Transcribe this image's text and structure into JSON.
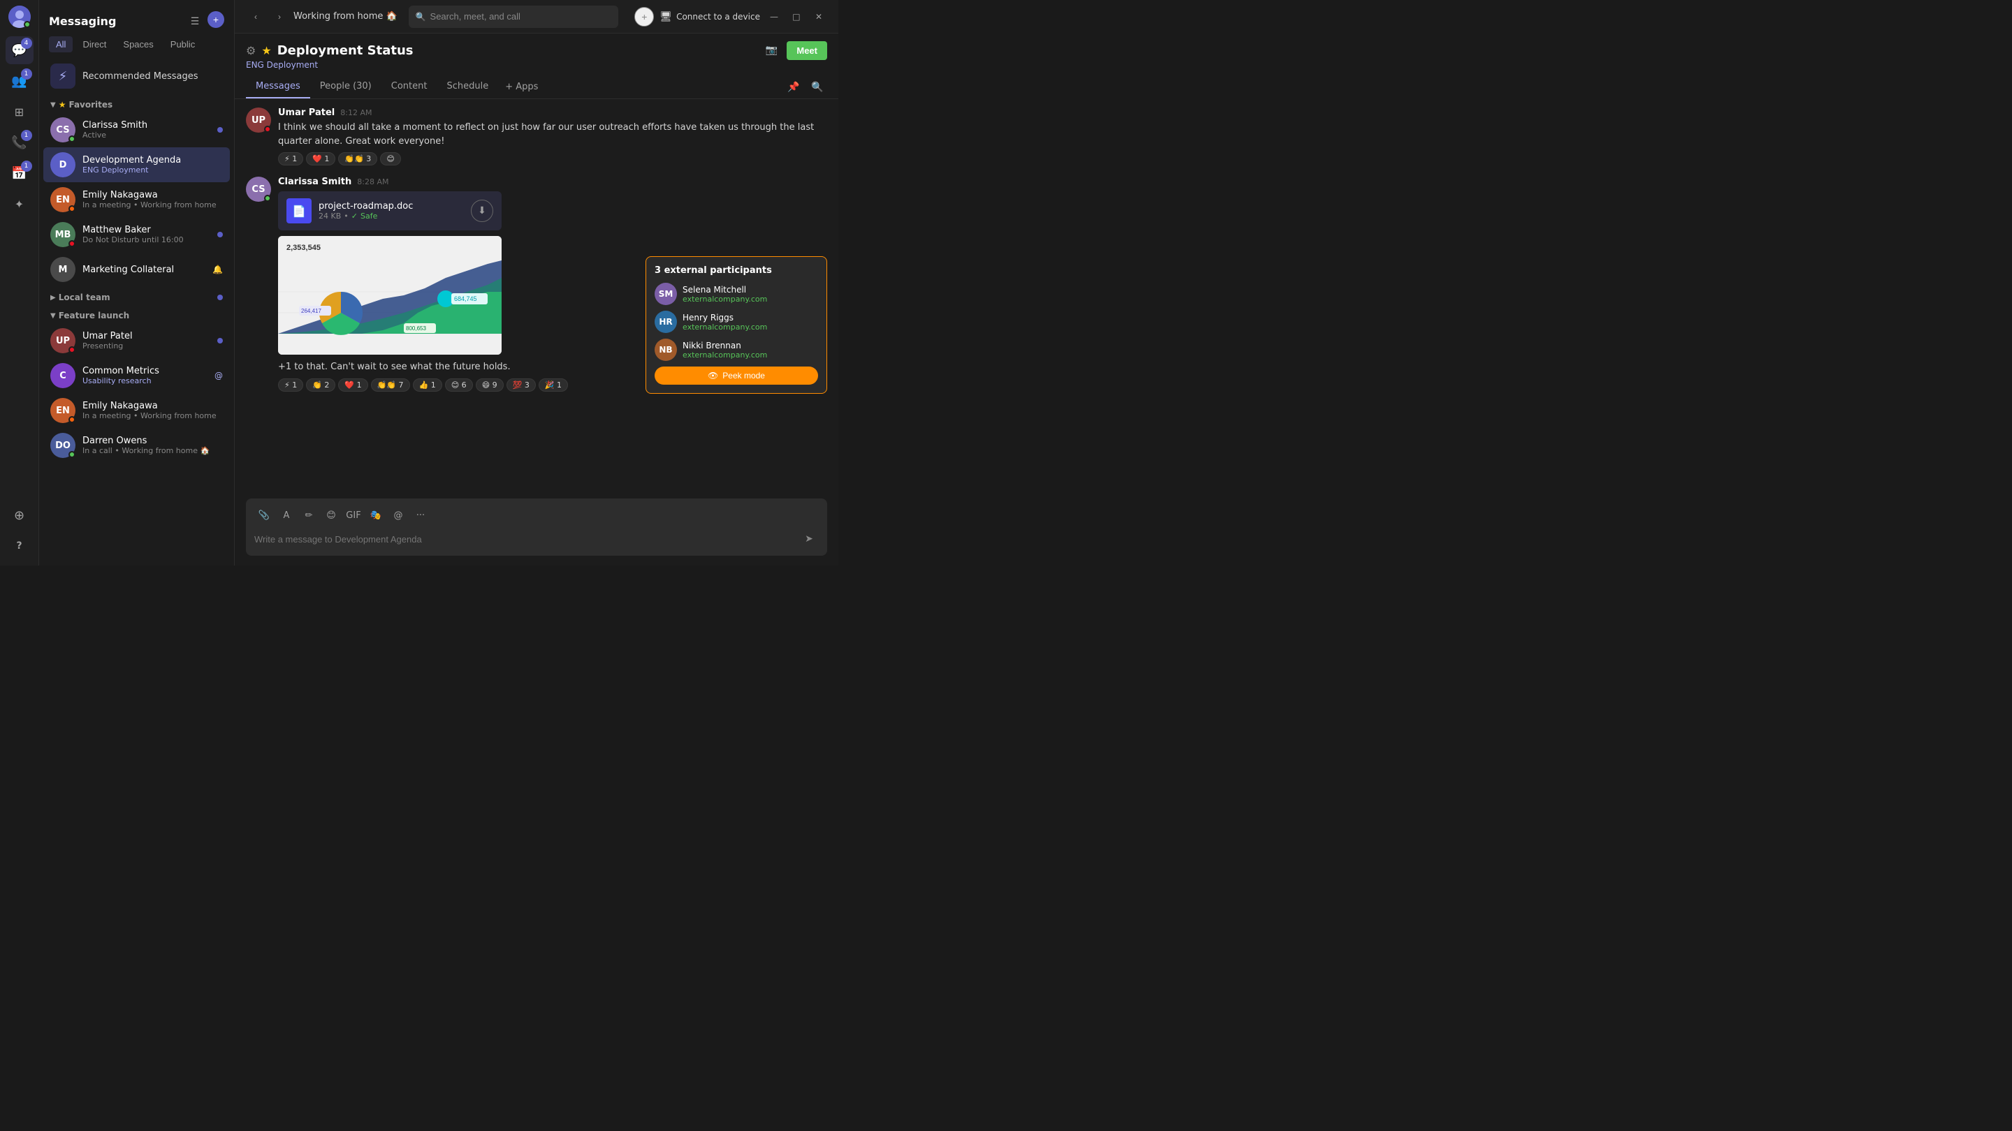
{
  "topBar": {
    "title": "Working from home 🏠",
    "searchPlaceholder": "Search, meet, and call",
    "connectBtn": "Connect to a device"
  },
  "sidebar": {
    "title": "Messaging",
    "tabs": [
      "All",
      "Direct",
      "Spaces",
      "Public"
    ],
    "activeTab": "All",
    "recommendedMessages": "Recommended Messages",
    "sections": {
      "favorites": {
        "label": "Favorites",
        "expanded": true,
        "items": [
          {
            "id": "clarissa",
            "name": "Clarissa Smith",
            "sub": "Active",
            "status": "green",
            "hasBadge": true,
            "bgColor": "#8b6fad"
          },
          {
            "id": "dev-agenda",
            "name": "Development Agenda",
            "sub": "ENG Deployment",
            "status": null,
            "hasBadge": false,
            "bgColor": "#5b5fc7",
            "letter": "D",
            "active": true
          },
          {
            "id": "emily1",
            "name": "Emily Nakagawa",
            "sub": "In a meeting • Working from home",
            "status": "orange",
            "hasBadge": false,
            "bgColor": "#c45b2a"
          },
          {
            "id": "matthew",
            "name": "Matthew Baker",
            "sub": "Do Not Disturb until 16:00",
            "status": "dnd",
            "hasBadge": true,
            "bgColor": "#4a7c59"
          }
        ]
      },
      "localTeam": {
        "label": "Local team",
        "expanded": false,
        "hasBadge": true
      },
      "featureLaunch": {
        "label": "Feature launch",
        "expanded": true,
        "items": [
          {
            "id": "umar",
            "name": "Umar Patel",
            "sub": "Presenting",
            "status": "presenting",
            "hasBadge": true,
            "bgColor": "#8b3a3a"
          },
          {
            "id": "common",
            "name": "Common Metrics",
            "sub": "Usability research",
            "status": null,
            "hasBadge": false,
            "bgColor": "#7b3fc7",
            "letter": "C",
            "hasAt": true
          },
          {
            "id": "emily2",
            "name": "Emily Nakagawa",
            "sub": "In a meeting • Working from home",
            "status": "orange",
            "hasBadge": false,
            "bgColor": "#c45b2a"
          },
          {
            "id": "darren",
            "name": "Darren Owens",
            "sub": "In a call • Working from home 🏠",
            "status": "green",
            "hasBadge": false,
            "bgColor": "#4a5c9a"
          }
        ]
      }
    },
    "marketing": {
      "name": "Marketing Collateral",
      "letter": "M",
      "bgColor": "#4a4a4a",
      "muted": true
    }
  },
  "channel": {
    "name": "Deployment Status",
    "sub": "ENG Deployment",
    "tabs": [
      "Messages",
      "People (30)",
      "Content",
      "Schedule",
      "+ Apps"
    ],
    "activeTab": "Messages",
    "messages": [
      {
        "id": "umar-msg",
        "author": "Umar Patel",
        "time": "8:12 AM",
        "text": "I think we should all take a moment to reflect on just how far our user outreach efforts have taken us through the last quarter alone. Great work everyone!",
        "reactions": [
          {
            "emoji": "⚡",
            "count": "1"
          },
          {
            "emoji": "❤️",
            "count": "1"
          },
          {
            "emoji": "👏👏",
            "count": "3"
          },
          {
            "emoji": "😊",
            "count": ""
          }
        ],
        "avatarBg": "#8b3a3a",
        "avatarLetter": "U"
      },
      {
        "id": "clarissa-msg",
        "author": "Clarissa Smith",
        "time": "8:28 AM",
        "file": {
          "name": "project-roadmap.doc",
          "size": "24 KB",
          "safe": true
        },
        "text": "+1 to that. Can't wait to see what the future holds.",
        "reactions": [
          {
            "emoji": "⚡",
            "count": "1"
          },
          {
            "emoji": "👏",
            "count": "2"
          },
          {
            "emoji": "❤️",
            "count": "1"
          },
          {
            "emoji": "👏👏",
            "count": "7"
          },
          {
            "emoji": "👍",
            "count": "1"
          },
          {
            "emoji": "😊",
            "count": "6"
          },
          {
            "emoji": "😄",
            "count": "9"
          },
          {
            "emoji": "💯",
            "count": "3"
          },
          {
            "emoji": "🎉",
            "count": "1"
          }
        ],
        "avatarBg": "#8b6fad",
        "avatarLetter": "C"
      }
    ],
    "inputPlaceholder": "Write a message to Development Agenda",
    "chart": {
      "title": "2,353,545",
      "label": "2,353,545"
    }
  },
  "externalParticipants": {
    "title": "3 external participants",
    "people": [
      {
        "name": "Selena Mitchell",
        "company": "externalcompany.com",
        "bg": "#7b5ea7"
      },
      {
        "name": "Henry Riggs",
        "company": "externalcompany.com",
        "bg": "#2a6ca0"
      },
      {
        "name": "Nikki Brennan",
        "company": "externalcompany.com",
        "bg": "#a05a2a"
      }
    ],
    "peekBtn": "Peek mode"
  },
  "icons": {
    "chat": "💬",
    "people": "👥",
    "calendar": "📅",
    "calls": "📞",
    "activity": "🔔",
    "apps": "⊞",
    "help": "?",
    "gear": "⚙",
    "star": "★",
    "search": "🔍",
    "send": "➤",
    "download": "⬇",
    "paperclip": "📎",
    "format": "A",
    "emoji": "😊",
    "meet": "📹",
    "pin": "📌",
    "peek": "👁"
  },
  "colors": {
    "accent": "#5b5fc7",
    "accentLight": "#a8adf4",
    "green": "#57c459",
    "orange": "#f7630c",
    "red": "#e81123",
    "gold": "#f5c518"
  }
}
